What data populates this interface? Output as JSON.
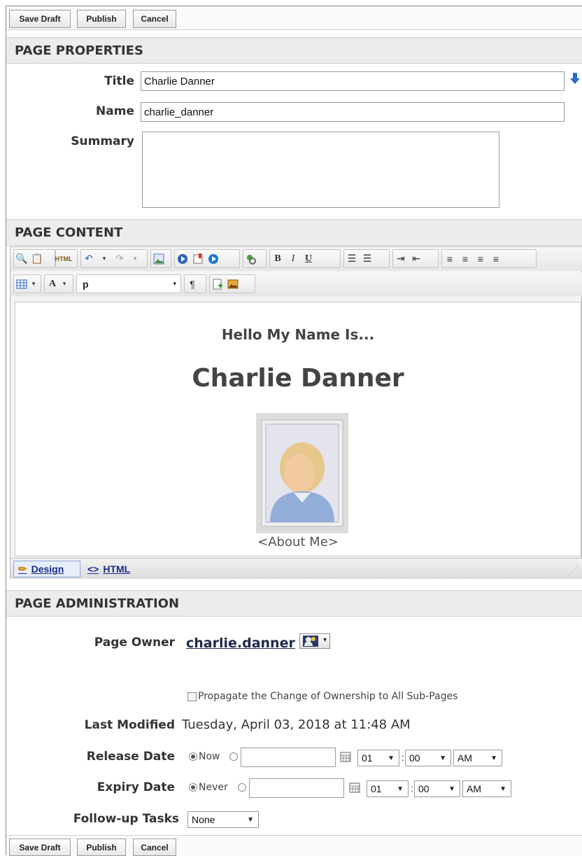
{
  "toolbar": {
    "save_draft": "Save Draft",
    "publish": "Publish",
    "cancel": "Cancel"
  },
  "properties": {
    "header": "PAGE PROPERTIES",
    "title_label": "Title",
    "title_value": "Charlie Danner",
    "name_label": "Name",
    "name_value": "charlie_danner",
    "summary_label": "Summary",
    "summary_value": ""
  },
  "content": {
    "header": "PAGE CONTENT",
    "format_value": "p",
    "hello": "Hello My Name Is...",
    "name": "Charlie Danner",
    "about": "<About Me>",
    "design_tab": "Design",
    "html_tab": "HTML"
  },
  "admin": {
    "header": "PAGE ADMINISTRATION",
    "owner_label": "Page Owner",
    "owner_value": "charlie.danner",
    "propagate_label": "Propagate the Change of Ownership to All Sub-Pages",
    "last_modified_label": "Last Modified",
    "last_modified_value": "Tuesday, April 03, 2018 at 11:48 AM",
    "release_label": "Release Date",
    "release_now": "Now",
    "release_hour": "01",
    "release_minute": "00",
    "release_ampm": "AM",
    "expiry_label": "Expiry Date",
    "expiry_never": "Never",
    "expiry_hour": "01",
    "expiry_minute": "00",
    "expiry_ampm": "AM",
    "followup_label": "Follow-up Tasks",
    "followup_value": "None"
  }
}
